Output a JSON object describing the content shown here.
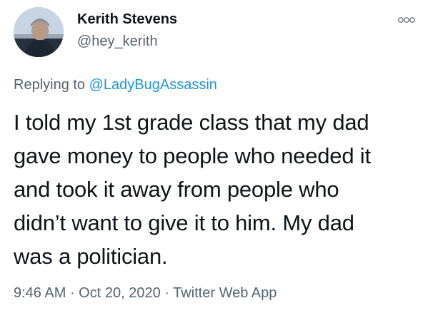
{
  "author": {
    "name": "Kerith Stevens",
    "handle": "@hey_kerith"
  },
  "reply": {
    "prefix": "Replying to ",
    "mention": "@LadyBugAssassin"
  },
  "tweet": {
    "lines": [
      "I told my 1st grade class that my dad",
      "gave money to people who needed it",
      "and took it away from people who",
      "didn’t want to give it to him. My dad",
      "was a politician."
    ]
  },
  "meta": {
    "time": "9:46 AM",
    "separator1": " · ",
    "date": "Oct 20, 2020",
    "separator2": " · ",
    "source": "Twitter Web App"
  },
  "icons": {
    "avatar": "profile-photo",
    "more": "more-options-icon"
  },
  "colors": {
    "text": "#0f1419",
    "secondary": "#536471",
    "mention": "#1b95e0"
  }
}
